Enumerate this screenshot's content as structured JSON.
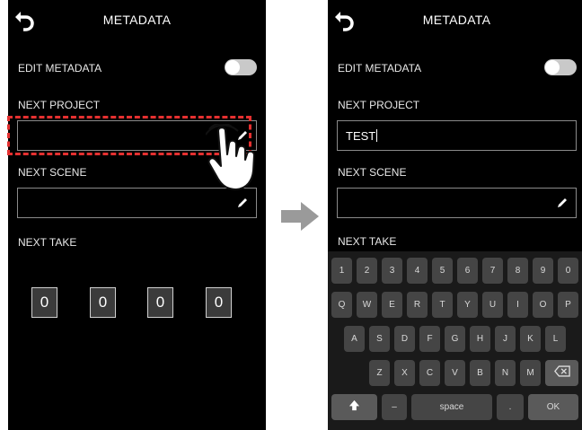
{
  "left": {
    "title": "METADATA",
    "edit_metadata_label": "EDIT METADATA",
    "next_project_label": "NEXT PROJECT",
    "next_project_value": "",
    "next_scene_label": "NEXT SCENE",
    "next_take_label": "NEXT TAKE",
    "take_digits": [
      "0",
      "0",
      "0",
      "0"
    ]
  },
  "right": {
    "title": "METADATA",
    "edit_metadata_label": "EDIT METADATA",
    "next_project_label": "NEXT PROJECT",
    "next_project_value": "TEST",
    "next_scene_label": "NEXT SCENE",
    "next_take_label": "NEXT TAKE"
  },
  "keyboard": {
    "row1": [
      "1",
      "2",
      "3",
      "4",
      "5",
      "6",
      "7",
      "8",
      "9",
      "0"
    ],
    "row2": [
      "Q",
      "W",
      "E",
      "R",
      "T",
      "Y",
      "U",
      "I",
      "O",
      "P"
    ],
    "row3": [
      "A",
      "S",
      "D",
      "F",
      "G",
      "H",
      "J",
      "K",
      "L"
    ],
    "row4": [
      "Z",
      "X",
      "C",
      "V",
      "B",
      "N",
      "M"
    ],
    "dash_label": "–",
    "space_label": "space",
    "dot_label": ".",
    "ok_label": "OK"
  },
  "icons": {
    "back": "back-arrow-icon",
    "edit": "pencil-icon",
    "touch": "hand-tap-icon",
    "transition": "right-arrow-icon",
    "shift": "shift-up-arrow-icon",
    "backspace": "backspace-icon"
  },
  "colors": {
    "highlight": "#e53030",
    "screen_bg": "#000000",
    "key_bg": "#454545",
    "toggle_bg": "#c9c9c9"
  }
}
